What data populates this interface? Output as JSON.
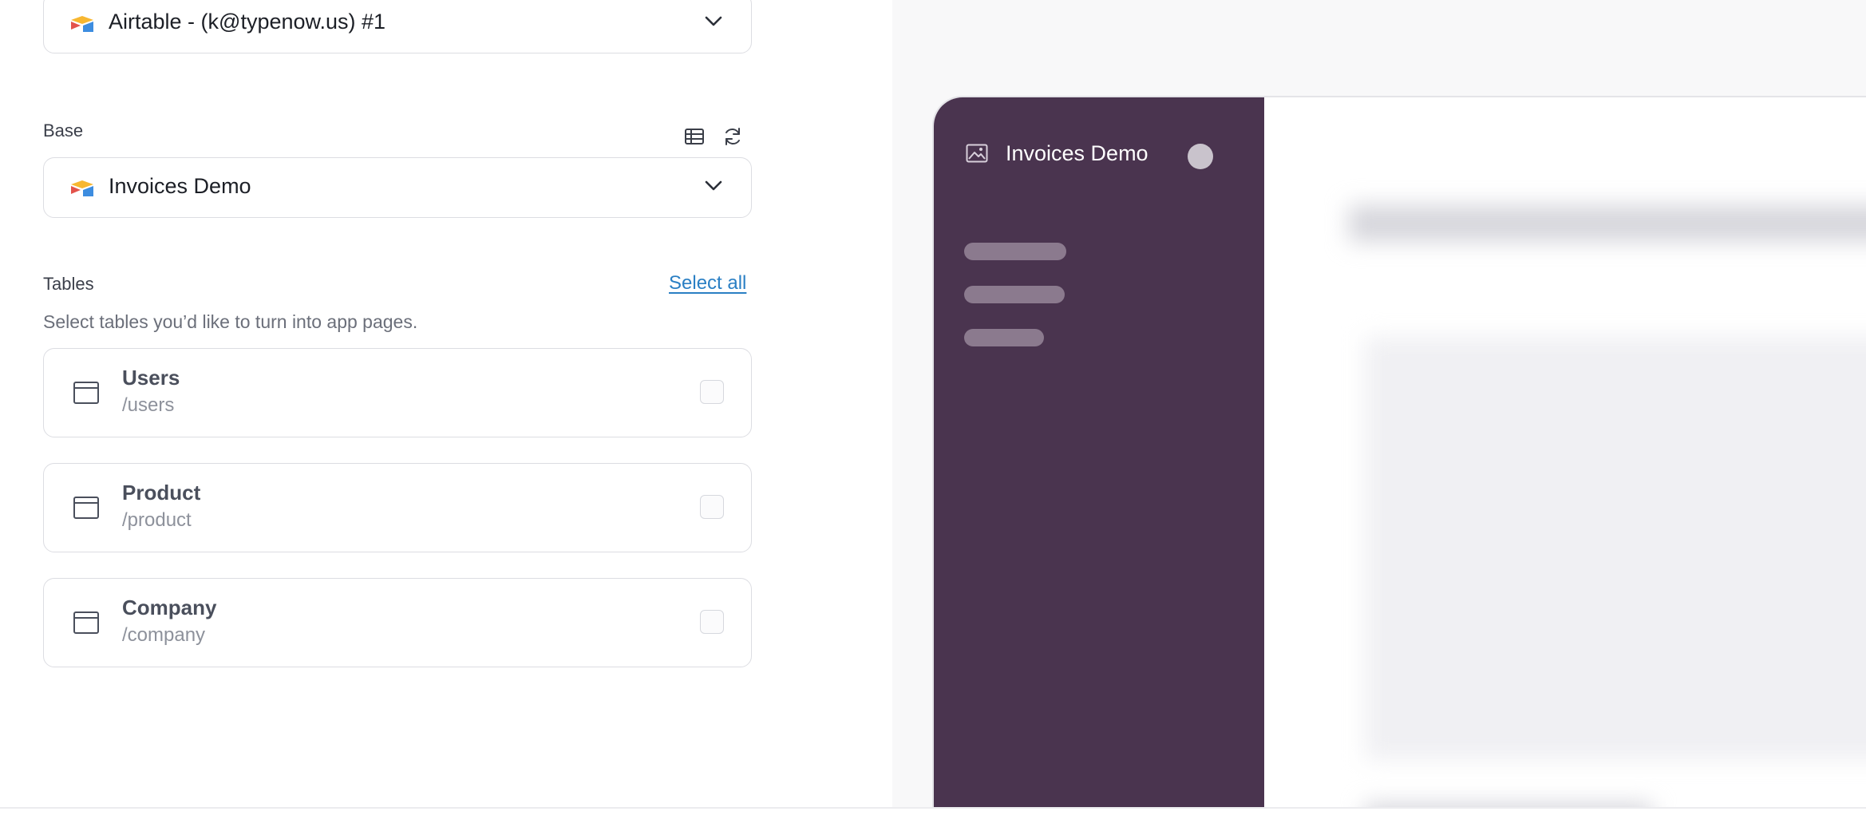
{
  "connection": {
    "value": "Airtable - (k@typenow.us) #1"
  },
  "base": {
    "label": "Base",
    "value": "Invoices Demo"
  },
  "tables_section": {
    "label": "Tables",
    "select_all": "Select all",
    "hint": "Select tables you’d like to turn into app pages.",
    "items": [
      {
        "name": "Users",
        "path": "/users",
        "checked": false
      },
      {
        "name": "Product",
        "path": "/product",
        "checked": false
      },
      {
        "name": "Company",
        "path": "/company",
        "checked": false
      }
    ]
  },
  "preview": {
    "app_name": "Invoices Demo",
    "sidebar_color": "#4a344f"
  },
  "colors": {
    "link": "#2a7fc4"
  },
  "icons": {
    "base_tools": [
      "table-view-icon",
      "refresh-icon"
    ],
    "table_item": "table-window-icon",
    "select": "airtable-logo",
    "preview_app": "image-icon"
  }
}
